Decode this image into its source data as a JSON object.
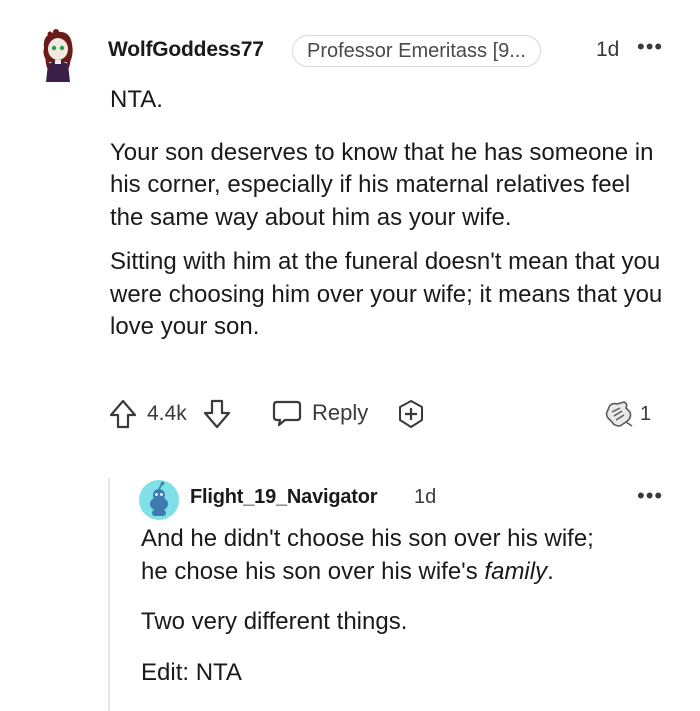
{
  "comment": {
    "username": "WolfGoddess77",
    "flair": "Professor Emeritass [9...",
    "time": "1d",
    "more": "•••",
    "body": [
      "NTA.",
      "Your son deserves to know that he has someone in his corner, especially if his maternal relatives feel the same way about him as your wife.",
      "Sitting with him at the funeral doesn't mean that you were choosing him over your wife; it means that you love your son."
    ],
    "actions": {
      "vote_count": "4.4k",
      "reply_label": "Reply",
      "award_count": "1"
    }
  },
  "reply": {
    "username": "Flight_19_Navigator",
    "time": "1d",
    "more": "•••",
    "line1": "And he didn't choose his son over his wife;",
    "line2_prefix": "he chose his son over his wife's ",
    "line2_italic": "family",
    "line2_suffix": ".",
    "para2": "Two very different things.",
    "para3": "Edit: NTA"
  },
  "colors": {
    "text": "#1a1a1b",
    "meta": "#3a3a3a",
    "flair_border": "#d8d8d8",
    "reply_avatar": "#7fe0e8",
    "thread_line": "#e6e6e6"
  }
}
